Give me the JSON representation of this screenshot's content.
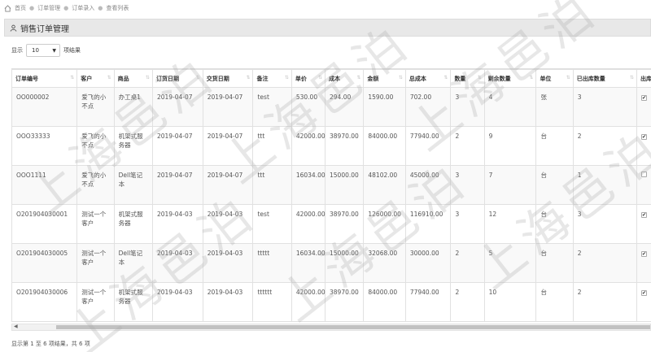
{
  "breadcrumb": {
    "items": [
      "首页",
      "订单管理",
      "订单录入",
      "查看列表"
    ]
  },
  "panel": {
    "title": "销售订单管理"
  },
  "length": {
    "show_label": "显示",
    "value": "10",
    "suffix": "项结果"
  },
  "table": {
    "columns": [
      "订单编号",
      "客户",
      "商品",
      "订货日期",
      "交货日期",
      "备注",
      "单价",
      "成本",
      "金额",
      "总成本",
      "数量",
      "剩余数量",
      "单位",
      "已出库数量",
      "出库"
    ],
    "rows": [
      [
        "OO000002",
        "爱飞的小不点",
        "办工桌1",
        "2019-04-07",
        "2019-04-07",
        "test",
        "530.00",
        "294.00",
        "1590.00",
        "702.00",
        "3",
        "4",
        "张",
        "3",
        "✔"
      ],
      [
        "OOO33333",
        "爱飞的小不点",
        "机架式服务器",
        "2019-04-07",
        "2019-04-07",
        "ttt",
        "42000.00",
        "38970.00",
        "84000.00",
        "77940.00",
        "2",
        "9",
        "台",
        "2",
        "✔"
      ],
      [
        "OOO1111",
        "爱飞的小不点",
        "Dell笔记本",
        "2019-04-07",
        "2019-04-07",
        "ttt",
        "16034.00",
        "15000.00",
        "48102.00",
        "45000.00",
        "3",
        "7",
        "台",
        "1",
        ""
      ],
      [
        "O201904030001",
        "测试一个客户",
        "机架式服务器",
        "2019-04-03",
        "2019-04-03",
        "test",
        "42000.00",
        "38970.00",
        "126000.00",
        "116910.00",
        "3",
        "12",
        "台",
        "3",
        "✔"
      ],
      [
        "O201904030005",
        "测试一个客户",
        "Dell笔记本",
        "2019-04-03",
        "2019-04-03",
        "ttttt",
        "16034.00",
        "15000.00",
        "32068.00",
        "30000.00",
        "2",
        "5",
        "台",
        "2",
        "✔"
      ],
      [
        "O201904030006",
        "测试一个客户",
        "机架式服务器",
        "2019-04-03",
        "2019-04-03",
        "tttttt",
        "42000.00",
        "38970.00",
        "84000.00",
        "77940.00",
        "2",
        "10",
        "台",
        "2",
        "✔"
      ]
    ]
  },
  "info": {
    "text": "显示第 1 至 6 项结果，共 6 项"
  },
  "watermark": {
    "text": "上海邑泊"
  },
  "colors": {
    "header_bg": "#e8e8e8",
    "row_alt": "#f9f9f9"
  }
}
